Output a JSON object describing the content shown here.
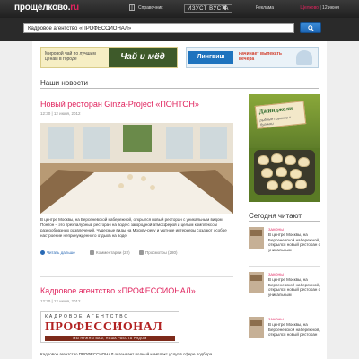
{
  "header": {
    "logo_main": "прощёлково.",
    "logo_tld": "ru",
    "nav_reference": "Справочник",
    "nav_brand": "ИЗУСТ ВУСТА",
    "nav_ads": "Реклама",
    "city_prefix": "Щелково",
    "city_date": "| 12 июня"
  },
  "search": {
    "value": "Кадровое агентство «ПРОФЕССИОНАЛ»"
  },
  "banners": {
    "left_text": "Мировой чай по лучшим ценам в городе",
    "left_brand": "Чай и мёд",
    "right_brand": "Лингвиш",
    "right_text": "начинает выпекать вечера"
  },
  "section": {
    "title": "Наши новости"
  },
  "articles": [
    {
      "title": "Новый ресторан Ginza-Project «ПОНТОН»",
      "date": "12:30 | 12 июня, 2012",
      "text": "В центре Москвы, на Берсеневской набережной, открылся новый ресторан с уникальным видом. Понтон – это трехпалубный ресторан на воде с загородной атмосферой и целым комплексом разнообразных развлечений. Чудесные виды на Москву-реку и уютные интерьеры создают особое настроение непринужденного отдыха на воде.",
      "read_more": "Читать дальше",
      "comments": "Комментарии (22)",
      "views": "Просмотры (280)"
    },
    {
      "title": "Кадровое агентство «ПРОФЕССИОНАЛ»",
      "date": "12:30 | 12 июня, 2012",
      "logo_top": "КАДРОВОЕ АГЕНТСТВО",
      "logo_big": "ПРОФЕССИОНАЛ",
      "logo_bar": "МЫ НУЖНЫ ВАМ, НАША РАБОТА РЯДОМ",
      "text": "Кадровое агентство ПРОФЕССИОНАЛ оказывает полный комплекс услуг в сфере подбора"
    }
  ],
  "sidebar": {
    "ad_title": "Джинджоли",
    "ad_subtitle": "рыбные пирожки и булочки",
    "reading_title": "Сегодня читают",
    "items": [
      {
        "label": "ЗАКОНЫ",
        "text": "В центре Москвы, на Берсеневской набережной, открылся новый ресторан с уникальным"
      },
      {
        "label": "ЗАКОНЫ",
        "text": "В центре Москвы, на Берсеневской набережной, открылся новый ресторан с уникальным"
      },
      {
        "label": "ЗАКОНЫ",
        "text": "В центре Москвы, на Берсеневской набережной, открылся новый ресторан"
      }
    ]
  }
}
